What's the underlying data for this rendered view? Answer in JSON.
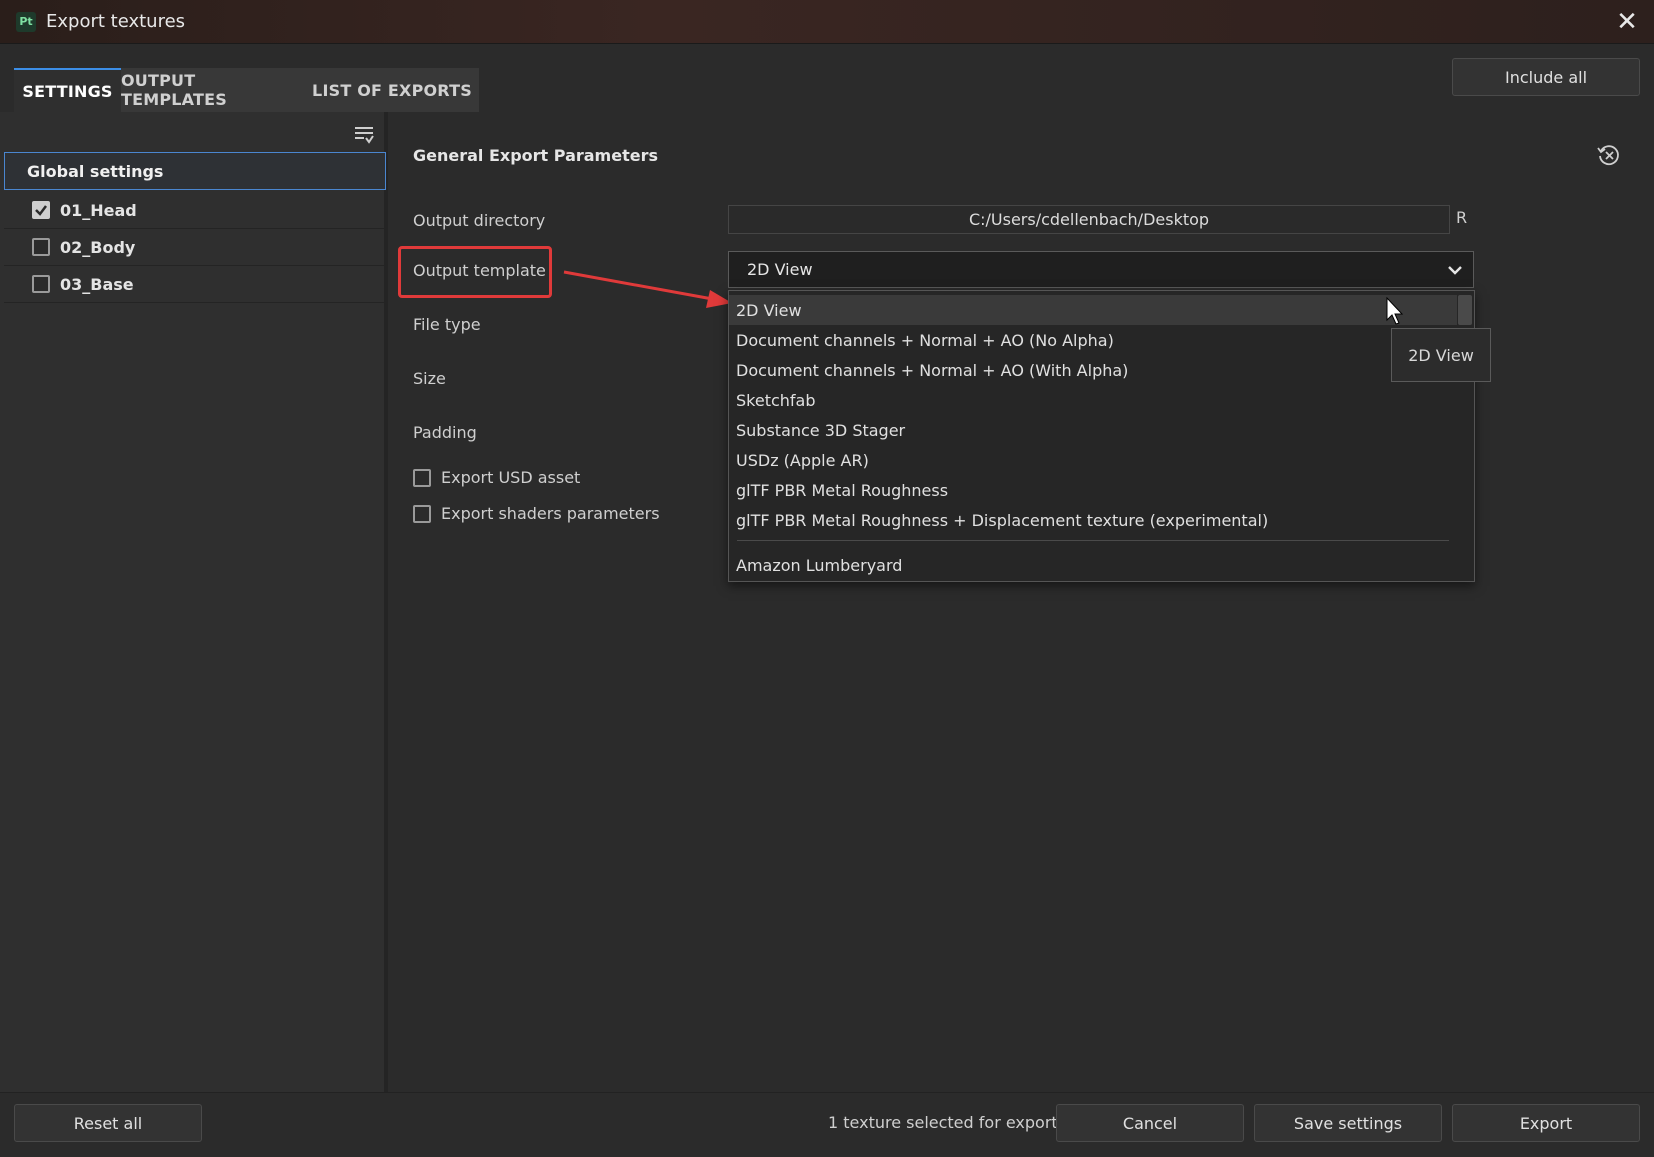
{
  "window": {
    "title": "Export textures",
    "app_badge": "Pt"
  },
  "tabs": [
    {
      "label": "SETTINGS",
      "active": true
    },
    {
      "label": "OUTPUT TEMPLATES",
      "active": false
    },
    {
      "label": "LIST OF EXPORTS",
      "active": false
    }
  ],
  "include_all_label": "Include all",
  "sidebar": {
    "global_label": "Global settings",
    "meshes": [
      {
        "label": "01_Head",
        "checked": true
      },
      {
        "label": "02_Body",
        "checked": false
      },
      {
        "label": "03_Base",
        "checked": false
      }
    ]
  },
  "params": {
    "section_title": "General Export Parameters",
    "output_directory_label": "Output directory",
    "output_directory_value": "C:/Users/cdellenbach/Desktop",
    "r_button": "R",
    "output_template_label": "Output template",
    "output_template_value": "2D View",
    "file_type_label": "File type",
    "size_label": "Size",
    "padding_label": "Padding",
    "export_usd_label": "Export USD asset",
    "export_shaders_label": "Export shaders parameters"
  },
  "dropdown": {
    "items": [
      "2D View",
      "Document channels + Normal + AO (No Alpha)",
      "Document channels + Normal + AO (With Alpha)",
      "Sketchfab",
      "Substance 3D Stager",
      "USDz (Apple AR)",
      "glTF PBR Metal Roughness",
      "glTF PBR Metal Roughness + Displacement texture (experimental)"
    ],
    "after_separator": "Amazon Lumberyard",
    "tooltip": "2D View"
  },
  "footer": {
    "reset_label": "Reset all",
    "status": "1 texture selected for export",
    "cancel_label": "Cancel",
    "save_label": "Save settings",
    "export_label": "Export"
  },
  "colors": {
    "accent": "#3c8ee6",
    "annotation": "#e03a3a"
  }
}
